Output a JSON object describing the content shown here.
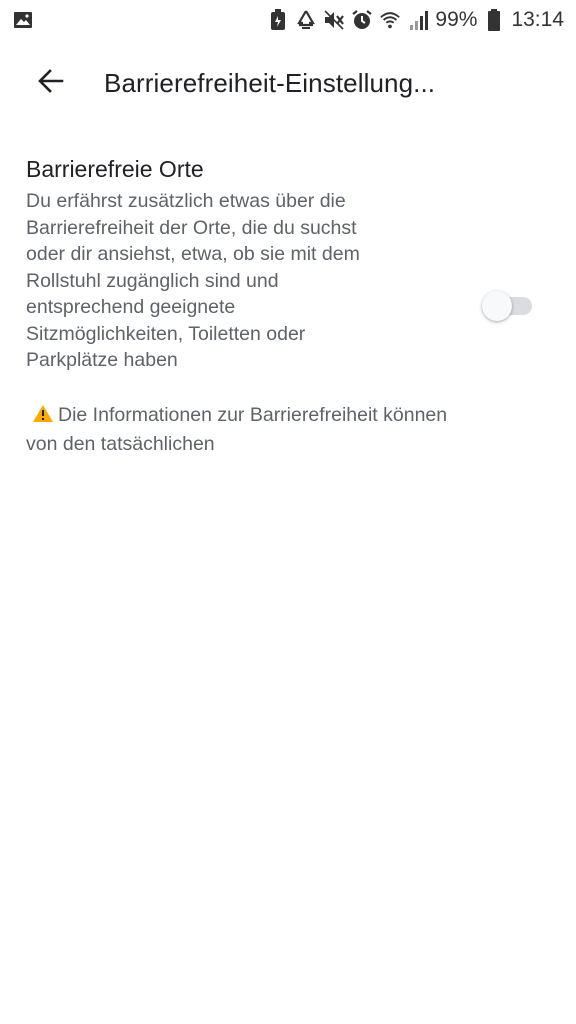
{
  "status_bar": {
    "battery_percent": "99%",
    "time": "13:14",
    "icons": [
      "image-icon",
      "battery-saver-icon",
      "recycle-icon",
      "mute-icon",
      "alarm-icon",
      "wifi-icon",
      "signal-icon",
      "battery-icon"
    ]
  },
  "app_bar": {
    "back_icon": "arrow-back-icon",
    "title": "Barrierefreiheit-Einstellung..."
  },
  "setting": {
    "title": "Barrierefreie Orte",
    "description": "Du erfährst zusätzlich etwas über die Barrierefreiheit der Orte, die du suchst oder dir ansiehst, etwa, ob sie mit dem Rollstuhl zugänglich sind und entsprechend geeignete Sitzmöglichkeiten, Toiletten oder Parkplätze haben",
    "toggle_on": false
  },
  "warning": {
    "icon": "warning-icon",
    "text": "Die Informationen zur Barrierefreiheit können von den tatsächlichen"
  },
  "colors": {
    "warning_icon": "#f9ab00",
    "toggle_track": "#dadce0",
    "toggle_thumb": "#f8f9fa"
  }
}
